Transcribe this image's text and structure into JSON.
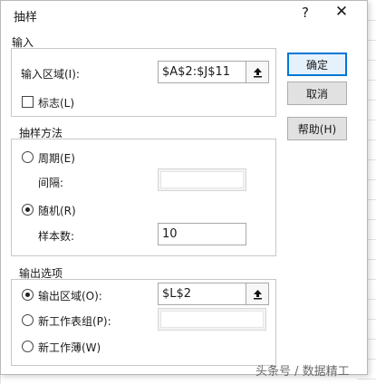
{
  "dialog": {
    "title": "抽样",
    "help_glyph": "?",
    "close_glyph": "✕"
  },
  "input_group": {
    "title": "输入",
    "range_label": "输入区域(I):",
    "range_value": "$A$2:$J$11",
    "labels_checkbox": "标志(L)",
    "labels_checked": false
  },
  "method_group": {
    "title": "抽样方法",
    "periodic_label": "周期(E)",
    "period_label": "间隔:",
    "period_value": "",
    "random_label": "随机(R)",
    "samples_label": "样本数:",
    "samples_value": "10",
    "selected": "random"
  },
  "output_group": {
    "title": "输出选项",
    "output_range_label": "输出区域(O):",
    "output_range_value": "$L$2",
    "new_sheet_label": "新工作表组(P):",
    "new_sheet_value": "",
    "new_workbook_label": "新工作薄(W)",
    "selected": "output_range"
  },
  "buttons": {
    "ok": "确定",
    "cancel": "取消",
    "help": "帮助(H)"
  },
  "watermark": "头条号 / 数据精工"
}
